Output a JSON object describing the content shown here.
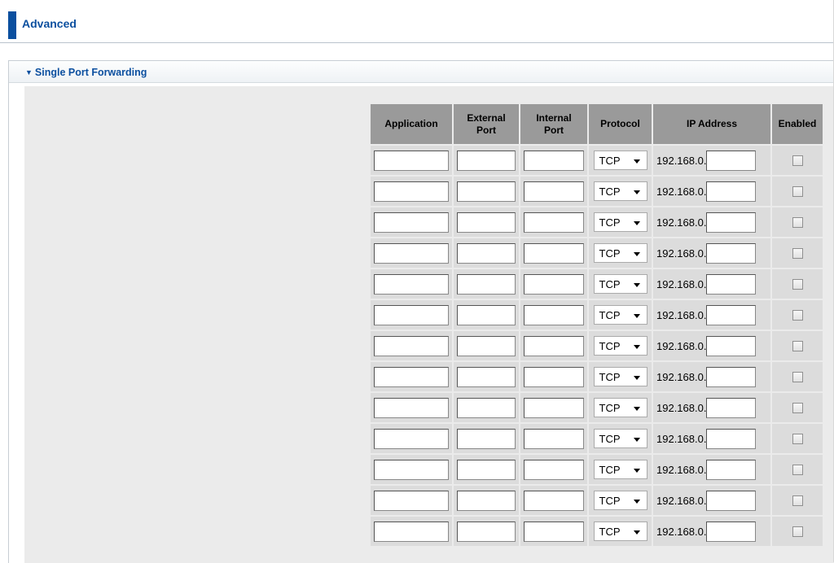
{
  "header": {
    "title": "Advanced"
  },
  "section": {
    "title": "Single Port Forwarding"
  },
  "table": {
    "columns": {
      "application": "Application",
      "external_port": "External Port",
      "internal_port": "Internal Port",
      "protocol": "Protocol",
      "ip_address": "IP Address",
      "enabled": "Enabled"
    },
    "rows": [
      {
        "application": "",
        "external_port": "",
        "internal_port": "",
        "protocol": "TCP",
        "ip_prefix": "192.168.0.",
        "ip_last": "",
        "enabled": false
      },
      {
        "application": "",
        "external_port": "",
        "internal_port": "",
        "protocol": "TCP",
        "ip_prefix": "192.168.0.",
        "ip_last": "",
        "enabled": false
      },
      {
        "application": "",
        "external_port": "",
        "internal_port": "",
        "protocol": "TCP",
        "ip_prefix": "192.168.0.",
        "ip_last": "",
        "enabled": false
      },
      {
        "application": "",
        "external_port": "",
        "internal_port": "",
        "protocol": "TCP",
        "ip_prefix": "192.168.0.",
        "ip_last": "",
        "enabled": false
      },
      {
        "application": "",
        "external_port": "",
        "internal_port": "",
        "protocol": "TCP",
        "ip_prefix": "192.168.0.",
        "ip_last": "",
        "enabled": false
      },
      {
        "application": "",
        "external_port": "",
        "internal_port": "",
        "protocol": "TCP",
        "ip_prefix": "192.168.0.",
        "ip_last": "",
        "enabled": false
      },
      {
        "application": "",
        "external_port": "",
        "internal_port": "",
        "protocol": "TCP",
        "ip_prefix": "192.168.0.",
        "ip_last": "",
        "enabled": false
      },
      {
        "application": "",
        "external_port": "",
        "internal_port": "",
        "protocol": "TCP",
        "ip_prefix": "192.168.0.",
        "ip_last": "",
        "enabled": false
      },
      {
        "application": "",
        "external_port": "",
        "internal_port": "",
        "protocol": "TCP",
        "ip_prefix": "192.168.0.",
        "ip_last": "",
        "enabled": false
      },
      {
        "application": "",
        "external_port": "",
        "internal_port": "",
        "protocol": "TCP",
        "ip_prefix": "192.168.0.",
        "ip_last": "",
        "enabled": false
      },
      {
        "application": "",
        "external_port": "",
        "internal_port": "",
        "protocol": "TCP",
        "ip_prefix": "192.168.0.",
        "ip_last": "",
        "enabled": false
      },
      {
        "application": "",
        "external_port": "",
        "internal_port": "",
        "protocol": "TCP",
        "ip_prefix": "192.168.0.",
        "ip_last": "",
        "enabled": false
      },
      {
        "application": "",
        "external_port": "",
        "internal_port": "",
        "protocol": "TCP",
        "ip_prefix": "192.168.0.",
        "ip_last": "",
        "enabled": false
      }
    ]
  },
  "colors": {
    "accent": "#0b4f9f",
    "table_header_bg": "#9a9a9a",
    "cell_bg": "#dcdcdc",
    "content_bg": "#ebebeb"
  },
  "icons": {
    "section_toggle": "triangle-down-icon",
    "select_arrow": "chevron-down-icon"
  }
}
